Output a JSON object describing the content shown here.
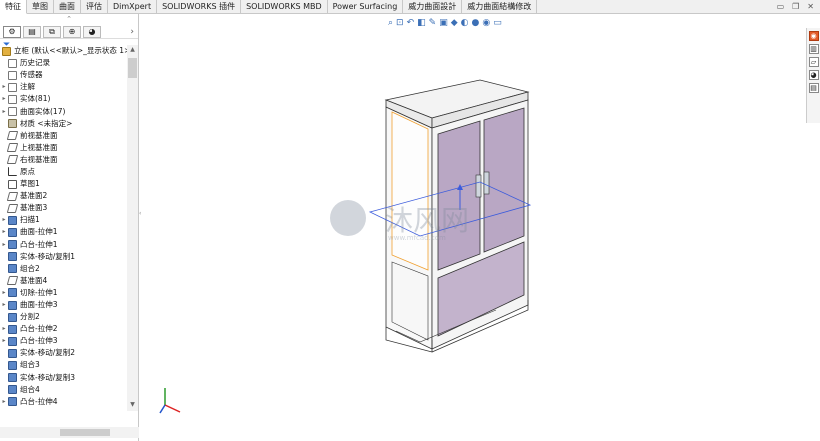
{
  "tabs": [
    {
      "label": "特征",
      "active": true
    },
    {
      "label": "草图"
    },
    {
      "label": "曲面"
    },
    {
      "label": "评估"
    },
    {
      "label": "DimXpert"
    },
    {
      "label": "SOLIDWORKS 插件"
    },
    {
      "label": "SOLIDWORKS MBD"
    },
    {
      "label": "Power Surfacing"
    },
    {
      "label": "威力曲面設計"
    },
    {
      "label": "威力曲面結構修改"
    }
  ],
  "feature_tree": {
    "root_label": "立柜 (默认<<默认>_显示状态 1>)",
    "items": [
      {
        "label": "历史记录",
        "icon": "history-icon",
        "expandable": false
      },
      {
        "label": "传感器",
        "icon": "sensor-icon",
        "expandable": false
      },
      {
        "label": "注解",
        "icon": "annotation-icon",
        "expandable": true
      },
      {
        "label": "实体(81)",
        "icon": "solid-bodies-icon",
        "expandable": true
      },
      {
        "label": "曲面实体(17)",
        "icon": "surface-bodies-icon",
        "expandable": true
      },
      {
        "label": "材质 <未指定>",
        "icon": "material-icon",
        "expandable": false
      },
      {
        "label": "前视基准面",
        "icon": "plane-icon",
        "expandable": false
      },
      {
        "label": "上视基准面",
        "icon": "plane-icon",
        "expandable": false
      },
      {
        "label": "右视基准面",
        "icon": "plane-icon",
        "expandable": false
      },
      {
        "label": "原点",
        "icon": "origin-icon",
        "expandable": false
      },
      {
        "label": "草图1",
        "icon": "sketch-icon",
        "expandable": false
      },
      {
        "label": "基准面2",
        "icon": "plane-icon",
        "expandable": false
      },
      {
        "label": "基准面3",
        "icon": "plane-icon",
        "expandable": false
      },
      {
        "label": "扫描1",
        "icon": "sweep-icon",
        "expandable": true
      },
      {
        "label": "曲面-拉伸1",
        "icon": "surface-extrude-icon",
        "expandable": true
      },
      {
        "label": "凸台-拉伸1",
        "icon": "boss-extrude-icon",
        "expandable": true
      },
      {
        "label": "实体-移动/复制1",
        "icon": "move-copy-icon",
        "expandable": false
      },
      {
        "label": "组合2",
        "icon": "combine-icon",
        "expandable": false
      },
      {
        "label": "基准面4",
        "icon": "plane-icon",
        "expandable": false
      },
      {
        "label": "切除-拉伸1",
        "icon": "cut-extrude-icon",
        "expandable": true
      },
      {
        "label": "曲面-拉伸3",
        "icon": "surface-extrude-icon",
        "expandable": true
      },
      {
        "label": "分割2",
        "icon": "split-icon",
        "expandable": false
      },
      {
        "label": "凸台-拉伸2",
        "icon": "boss-extrude-icon",
        "expandable": true
      },
      {
        "label": "凸台-拉伸3",
        "icon": "boss-extrude-icon",
        "expandable": true
      },
      {
        "label": "实体-移动/复制2",
        "icon": "move-copy-icon",
        "expandable": false
      },
      {
        "label": "组合3",
        "icon": "combine-icon",
        "expandable": false
      },
      {
        "label": "实体-移动/复制3",
        "icon": "move-copy-icon",
        "expandable": false
      },
      {
        "label": "组合4",
        "icon": "combine-icon",
        "expandable": false
      },
      {
        "label": "凸台-拉伸4",
        "icon": "boss-extrude-icon",
        "expandable": true
      }
    ]
  },
  "heads_up_toolbar": [
    "zoom-to-fit-icon",
    "zoom-area-icon",
    "previous-view-icon",
    "section-view-icon",
    "dynamic-annotation-icon",
    "view-orientation-icon",
    "display-style-icon",
    "hide-show-icon",
    "edit-appearance-icon",
    "apply-scene-icon",
    "view-settings-icon"
  ],
  "task_pane": [
    "solidworks-resources-icon",
    "design-library-icon",
    "file-explorer-icon",
    "appearances-icon",
    "custom-properties-icon"
  ],
  "colors": {
    "accent": "#3b6fb6",
    "door_panel": "#b9a7c4",
    "cabinet_edge": "#333333",
    "selection": "#f0a030"
  },
  "watermark": {
    "text": "沐风网",
    "url": "www.mfcad.com"
  }
}
